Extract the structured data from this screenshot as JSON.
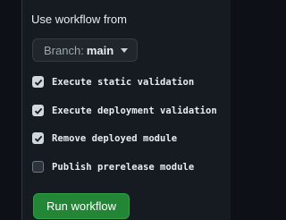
{
  "dialog": {
    "title": "Use workflow from",
    "branch": {
      "prefix": "Branch:",
      "name": "main"
    }
  },
  "inputs": [
    {
      "label": "Execute static validation",
      "checked": true
    },
    {
      "label": "Execute deployment validation",
      "checked": true
    },
    {
      "label": "Remove deployed module",
      "checked": true
    },
    {
      "label": "Publish prerelease module",
      "checked": false
    }
  ],
  "actions": {
    "run_label": "Run workflow",
    "run_color": "#238636"
  },
  "icons": {
    "caret": "triangle-down-icon",
    "check": "check-icon"
  }
}
